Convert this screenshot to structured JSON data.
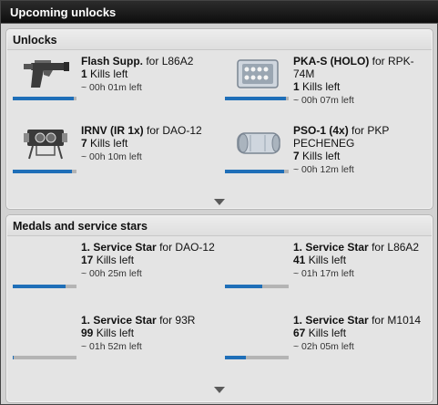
{
  "window": {
    "title": "Upcoming unlocks"
  },
  "unlocks": {
    "header": "Unlocks",
    "items": [
      {
        "name": "Flash Supp.",
        "for": " for L86A2",
        "kills": "1",
        "kills_suffix": " Kills left",
        "time": "~ 00h 01m left",
        "progress": 0.96,
        "icon": "flash-suppressor-pistol-icon"
      },
      {
        "name": "PKA-S (HOLO)",
        "for": " for RPK-74M",
        "kills": "1",
        "kills_suffix": " Kills left",
        "time": "~ 00h 07m left",
        "progress": 0.96,
        "icon": "holo-sight-icon"
      },
      {
        "name": "IRNV (IR 1x)",
        "for": " for DAO-12",
        "kills": "7",
        "kills_suffix": " Kills left",
        "time": "~ 00h 10m left",
        "progress": 0.93,
        "icon": "irnv-scope-icon"
      },
      {
        "name": "PSO-1 (4x)",
        "for": " for PKP PECHENEG",
        "kills": "7",
        "kills_suffix": " Kills left",
        "time": "~ 00h 12m left",
        "progress": 0.93,
        "icon": "pso-scope-icon"
      }
    ]
  },
  "medals": {
    "header": "Medals and service stars",
    "items": [
      {
        "name": "1. Service Star",
        "for": " for DAO-12",
        "kills": "17",
        "kills_suffix": " Kills left",
        "time": "~ 00h 25m left",
        "progress": 0.83
      },
      {
        "name": "1. Service Star",
        "for": " for L86A2",
        "kills": "41",
        "kills_suffix": " Kills left",
        "time": "~ 01h 17m left",
        "progress": 0.59
      },
      {
        "name": "1. Service Star",
        "for": " for 93R",
        "kills": "99",
        "kills_suffix": " Kills left",
        "time": "~ 01h 52m left",
        "progress": 0.01
      },
      {
        "name": "1. Service Star",
        "for": " for M1014",
        "kills": "67",
        "kills_suffix": " Kills left",
        "time": "~ 02h 05m left",
        "progress": 0.33
      }
    ]
  },
  "colors": {
    "accent": "#1f6fb8",
    "bar_track": "#b4b4b4",
    "titlebar": "#111111"
  }
}
